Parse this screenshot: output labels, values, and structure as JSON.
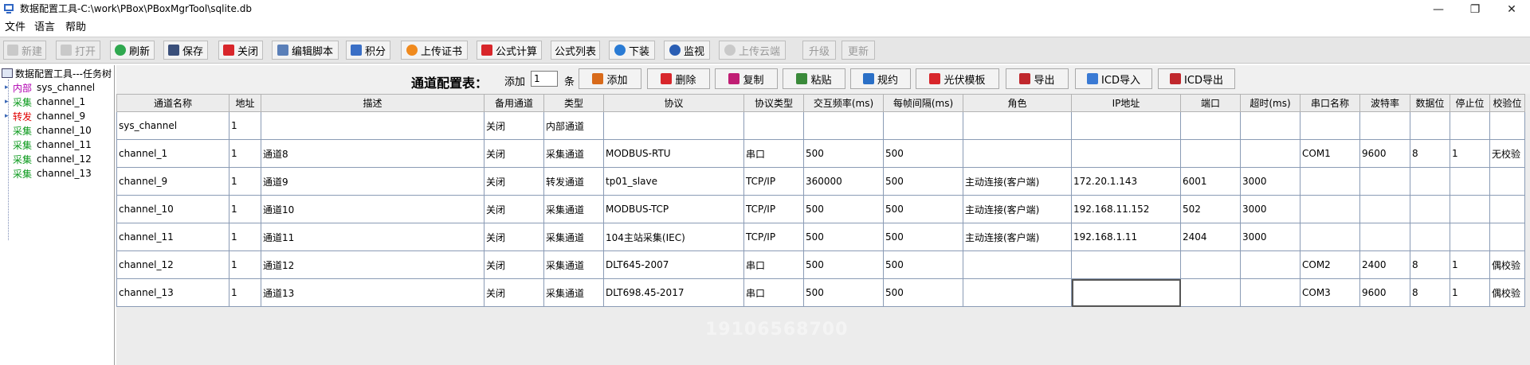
{
  "window": {
    "title": "数据配置工具-C:\\work\\PBox\\PBoxMgrTool\\sqlite.db",
    "minimize_glyph": "—",
    "maximize_glyph": "❐",
    "close_glyph": "✕"
  },
  "menu": [
    "文件",
    "语言",
    "帮助"
  ],
  "toolbar": [
    {
      "label": "新建",
      "icon": "new-file-icon",
      "disabled": true
    },
    {
      "label": "打开",
      "icon": "open-icon",
      "disabled": true
    },
    {
      "label": "刷新",
      "icon": "refresh-icon",
      "disabled": false
    },
    {
      "label": "保存",
      "icon": "save-icon",
      "disabled": false
    },
    {
      "label": "关闭",
      "icon": "power-icon",
      "disabled": false
    },
    {
      "label": "编辑脚本",
      "icon": "script-icon",
      "disabled": false
    },
    {
      "label": "积分",
      "icon": "integral-icon",
      "disabled": false
    },
    {
      "label": "上传证书",
      "icon": "certificate-icon",
      "disabled": false
    },
    {
      "label": "公式计算",
      "icon": "sigma-icon",
      "disabled": false
    },
    {
      "label": "公式列表",
      "icon": "",
      "disabled": false
    },
    {
      "label": "下装",
      "icon": "download-icon",
      "disabled": false
    },
    {
      "label": "监视",
      "icon": "monitor-icon",
      "disabled": false
    },
    {
      "label": "上传云端",
      "icon": "cloud-upload-icon",
      "disabled": true
    },
    {
      "label": "升级",
      "icon": "",
      "disabled": true
    },
    {
      "label": "更新",
      "icon": "",
      "disabled": true
    }
  ],
  "colors": {
    "cyan_cell": "#00ffff",
    "pink_cell": "#ffa8aa",
    "selected_cell": "#b8cce4",
    "tag_internal": "#b000b0",
    "tag_collect": "#0b9a1c",
    "tag_forward": "#e00000"
  },
  "tree": {
    "root": "数据配置工具---任务树",
    "items": [
      {
        "tag": "内部",
        "tag_kind": "nei",
        "name": "sys_channel",
        "expander": true
      },
      {
        "tag": "采集",
        "tag_kind": "cai",
        "name": "channel_1",
        "expander": true
      },
      {
        "tag": "转发",
        "tag_kind": "zhuan",
        "name": "channel_9",
        "expander": true
      },
      {
        "tag": "采集",
        "tag_kind": "cai",
        "name": "channel_10",
        "expander": false
      },
      {
        "tag": "采集",
        "tag_kind": "cai",
        "name": "channel_11",
        "expander": false
      },
      {
        "tag": "采集",
        "tag_kind": "cai",
        "name": "channel_12",
        "expander": false
      },
      {
        "tag": "采集",
        "tag_kind": "cai",
        "name": "channel_13",
        "expander": false
      }
    ]
  },
  "panel": {
    "title": "通道配置表：",
    "add_label": "添加",
    "add_count": "1",
    "unit_label": "条",
    "buttons": [
      {
        "label": "添加",
        "icon": "add-icon"
      },
      {
        "label": "删除",
        "icon": "delete-icon"
      },
      {
        "label": "复制",
        "icon": "copy-icon"
      },
      {
        "label": "粘贴",
        "icon": "paste-icon"
      },
      {
        "label": "规约",
        "icon": "protocol-icon"
      },
      {
        "label": "光伏模板",
        "icon": "solar-template-icon"
      },
      {
        "label": "导出",
        "icon": "export-icon"
      },
      {
        "label": "ICD导入",
        "icon": "icd-import-icon"
      },
      {
        "label": "ICD导出",
        "icon": "icd-export-icon"
      }
    ]
  },
  "table": {
    "columns": [
      "通道名称",
      "地址",
      "描述",
      "备用通道",
      "类型",
      "协议",
      "协议类型",
      "交互频率(ms)",
      "每帧间隔(ms)",
      "角色",
      "IP地址",
      "端口",
      "超时(ms)",
      "串口名称",
      "波特率",
      "数据位",
      "停止位",
      "校验位"
    ],
    "rows": [
      [
        "sys_channel",
        "1",
        "",
        "关闭",
        "内部通道",
        "",
        "",
        "",
        "",
        "",
        "",
        "",
        "",
        "",
        "",
        "",
        "",
        ""
      ],
      [
        "channel_1",
        "1",
        "通道8",
        "关闭",
        "采集通道",
        "MODBUS-RTU",
        "串口",
        "500",
        "500",
        "",
        "",
        "",
        "",
        "COM1",
        "9600",
        "8",
        "1",
        "无校验"
      ],
      [
        "channel_9",
        "1",
        "通道9",
        "关闭",
        "转发通道",
        "tp01_slave",
        "TCP/IP",
        "360000",
        "500",
        "主动连接(客户端)",
        "172.20.1.143",
        "6001",
        "3000",
        "",
        "",
        "",
        "",
        ""
      ],
      [
        "channel_10",
        "1",
        "通道10",
        "关闭",
        "采集通道",
        "MODBUS-TCP",
        "TCP/IP",
        "500",
        "500",
        "主动连接(客户端)",
        "192.168.11.152",
        "502",
        "3000",
        "",
        "",
        "",
        "",
        ""
      ],
      [
        "channel_11",
        "1",
        "通道11",
        "关闭",
        "采集通道",
        "104主站采集(IEC)",
        "TCP/IP",
        "500",
        "500",
        "主动连接(客户端)",
        "192.168.1.11",
        "2404",
        "3000",
        "",
        "",
        "",
        "",
        ""
      ],
      [
        "channel_12",
        "1",
        "通道12",
        "关闭",
        "采集通道",
        "DLT645-2007",
        "串口",
        "500",
        "500",
        "",
        "",
        "",
        "",
        "COM2",
        "2400",
        "8",
        "1",
        "偶校验"
      ],
      [
        "channel_13",
        "1",
        "通道13",
        "关闭",
        "采集通道",
        "DLT698.45-2017",
        "串口",
        "500",
        "500",
        "",
        "",
        "",
        "",
        "COM3",
        "9600",
        "8",
        "1",
        "偶校验"
      ]
    ]
  },
  "watermark": "19106568700"
}
